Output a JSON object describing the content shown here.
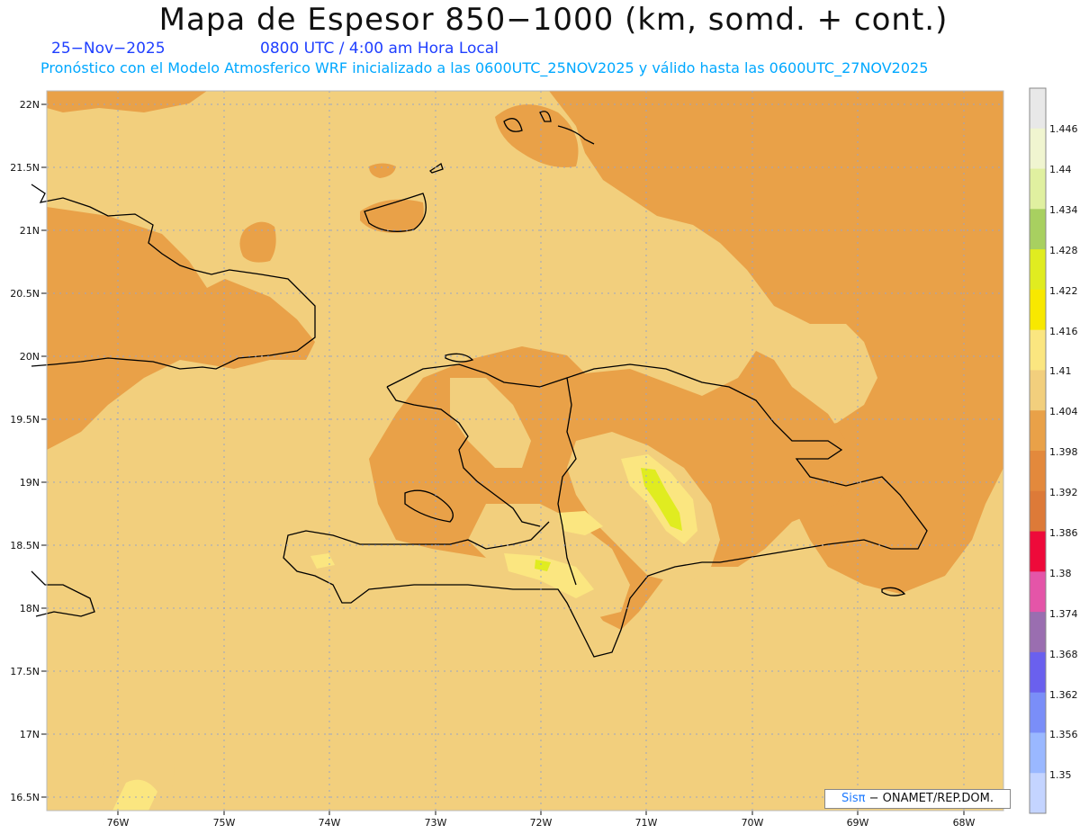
{
  "header": {
    "title": "Mapa de Espesor 850−1000 (km, somd. + cont.)",
    "date": "25−Nov−2025",
    "time": "0800 UTC / 4:00 am Hora Local",
    "subtitle": "Pronóstico con el Modelo Atmosferico WRF inicializado a las 0600UTC_25NOV2025 y válido hasta las  0600UTC_27NOV2025"
  },
  "axes": {
    "lat_labels": [
      "22N",
      "21.5N",
      "21N",
      "20.5N",
      "20N",
      "19.5N",
      "19N",
      "18.5N",
      "18N",
      "17.5N",
      "17N",
      "16.5N"
    ],
    "lon_labels": [
      "76W",
      "75W",
      "74W",
      "73W",
      "72W",
      "71W",
      "70W",
      "69W",
      "68W"
    ]
  },
  "colorbar": {
    "labels": [
      "1.446",
      "1.44",
      "1.434",
      "1.428",
      "1.422",
      "1.416",
      "1.41",
      "1.404",
      "1.398",
      "1.392",
      "1.386",
      "1.38",
      "1.374",
      "1.368",
      "1.362",
      "1.356",
      "1.35"
    ],
    "colors": [
      "#e8e8e8",
      "#f0f5d0",
      "#e0f0a0",
      "#a8d060",
      "#e0ec20",
      "#f8e800",
      "#fbe680",
      "#f2cf7d",
      "#e9a148",
      "#e3893c",
      "#dd7a38",
      "#ee0a3a",
      "#e455a8",
      "#9a6eb0",
      "#6a60ee",
      "#7a8ef8",
      "#9ab8ff",
      "#c4d4ff"
    ],
    "min": 1.35,
    "max": 1.446,
    "step": 0.006
  },
  "credit": {
    "brand": "Sisπ",
    "text": "− ONAMET/REP.DOM."
  }
}
